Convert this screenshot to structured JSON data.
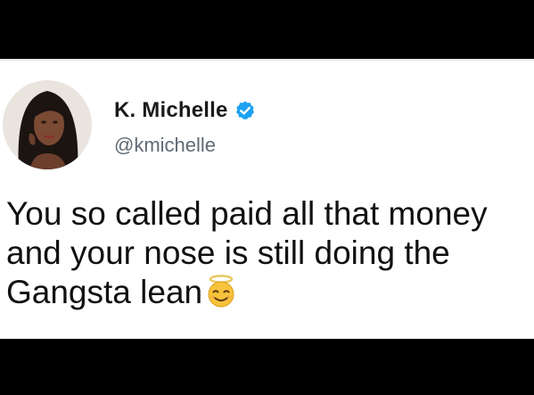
{
  "tweet": {
    "author": {
      "display_name": "K. Michelle",
      "handle": "@kmichelle",
      "verified": true,
      "avatar_icon": "profile-photo-icon"
    },
    "text_lines": [
      "You so called paid all that money",
      "and your nose is still doing the",
      "Gangsta lean"
    ],
    "trailing_emoji_icon": "smiling-face-with-halo-icon"
  },
  "colors": {
    "background": "#000000",
    "card": "#ffffff",
    "verified_badge": "#1da1f2",
    "handle_text": "#5f6a73"
  }
}
